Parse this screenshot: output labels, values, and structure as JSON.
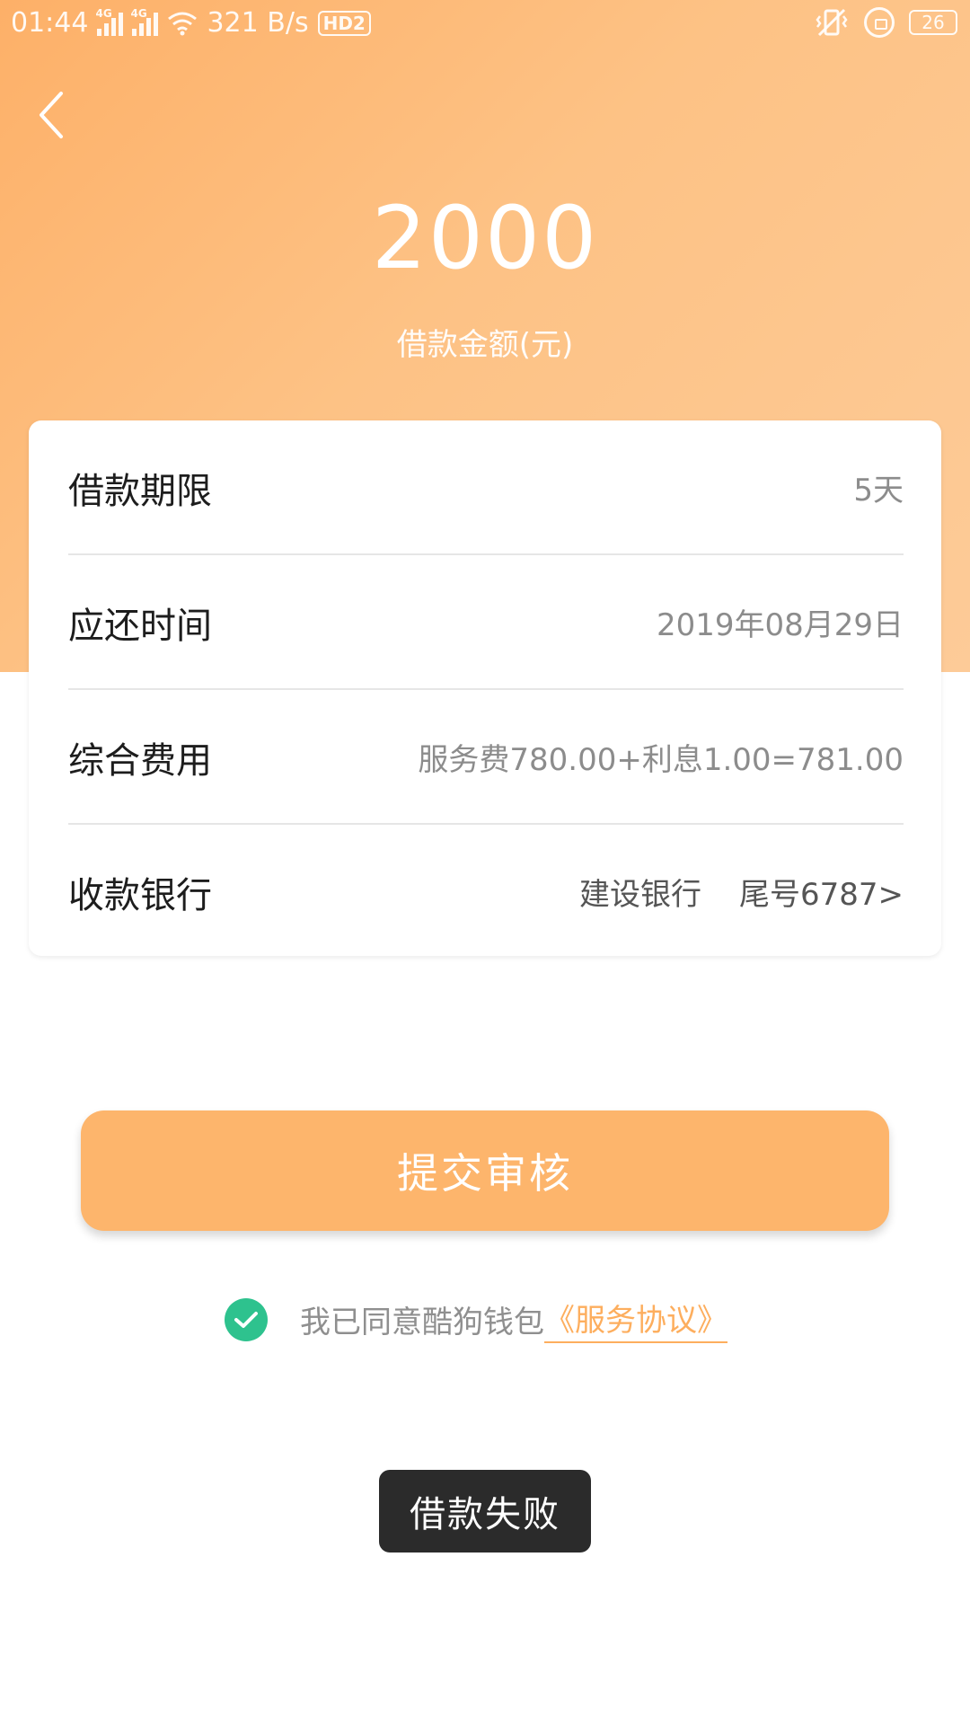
{
  "status_bar": {
    "time": "01:44",
    "network_speed": "321 B/s",
    "hd_label": "HD2",
    "battery": "26",
    "signal_tag": "4G"
  },
  "header": {
    "amount": "2000",
    "amount_label": "借款金额(元)"
  },
  "details": [
    {
      "label": "借款期限",
      "value": "5天"
    },
    {
      "label": "应还时间",
      "value": "2019年08月29日"
    },
    {
      "label": "综合费用",
      "value": "服务费780.00+利息1.00=781.00"
    }
  ],
  "bank": {
    "label": "收款银行",
    "bank_name": "建设银行",
    "tail": "尾号6787>"
  },
  "submit_label": "提交审核",
  "agreement": {
    "text": "我已同意酷狗钱包",
    "link": "《服务协议》"
  },
  "toast": "借款失败",
  "colors": {
    "header_start": "#fdb068",
    "header_end": "#fdcb98",
    "button": "#fdb56c",
    "check": "#2ec28e",
    "link": "#fdae5e"
  },
  "icons": [
    "back-arrow-icon",
    "signal-icon",
    "wifi-icon",
    "hd-icon",
    "vibrate-icon",
    "rotation-lock-icon",
    "battery-icon",
    "check-circle-icon"
  ]
}
